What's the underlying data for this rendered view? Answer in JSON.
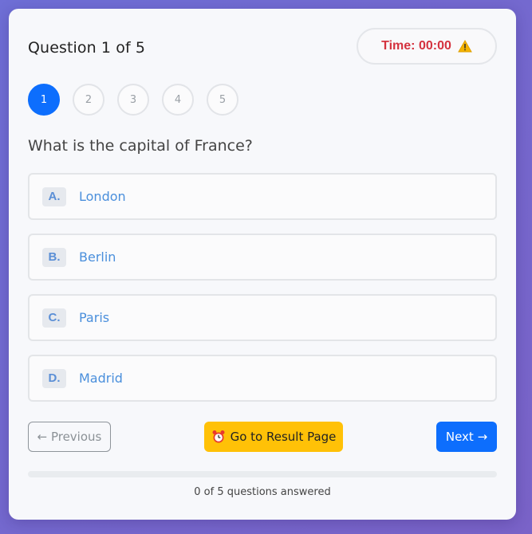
{
  "header": {
    "title": "Question 1 of 5",
    "timer": "Time: 00:00"
  },
  "icons": {
    "timer_icon": "warning-icon",
    "result_icon": "alarm-clock-icon"
  },
  "steps": [
    "1",
    "2",
    "3",
    "4",
    "5"
  ],
  "active_step": 1,
  "question": "What is the capital of France?",
  "options": [
    {
      "letter": "A.",
      "text": "London"
    },
    {
      "letter": "B.",
      "text": "Berlin"
    },
    {
      "letter": "C.",
      "text": "Paris"
    },
    {
      "letter": "D.",
      "text": "Madrid"
    }
  ],
  "buttons": {
    "previous": "← Previous",
    "result": "Go to Result Page",
    "next": "Next →"
  },
  "progress": {
    "fraction": 0,
    "text": "0 of 5 questions answered"
  },
  "colors": {
    "primary": "#0d6efd",
    "timer": "#d4323f",
    "result_button": "#ffc107",
    "option_text": "#4a8fdc"
  }
}
